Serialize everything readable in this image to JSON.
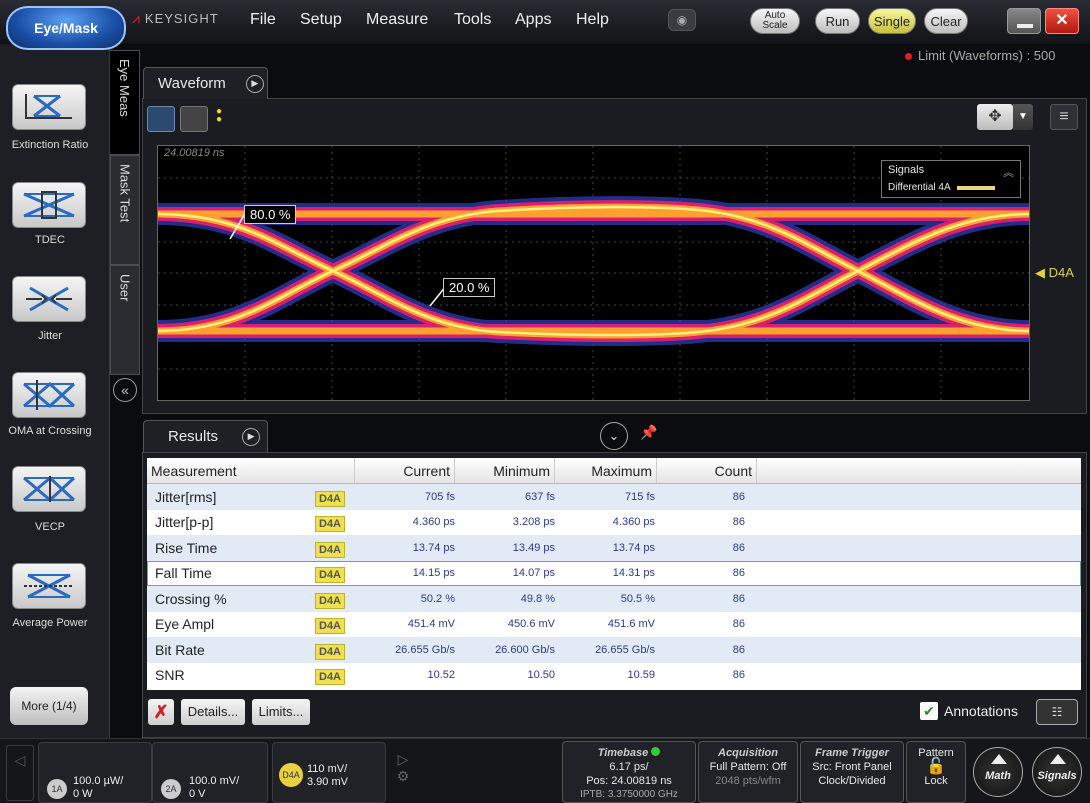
{
  "app": {
    "mode_button": "Eye/Mask",
    "brand": "KEYSIGHT"
  },
  "menu": [
    "File",
    "Setup",
    "Measure",
    "Tools",
    "Apps",
    "Help"
  ],
  "toolbar": {
    "autoscale_line1": "Auto",
    "autoscale_line2": "Scale",
    "run": "Run",
    "single": "Single",
    "clear": "Clear",
    "close": "✕"
  },
  "limit_text": "Limit (Waveforms) : 500",
  "left_panel": {
    "items": [
      {
        "label": "Extinction Ratio",
        "icon": "extinction-ratio-icon"
      },
      {
        "label": "TDEC",
        "icon": "tdec-icon"
      },
      {
        "label": "Jitter",
        "icon": "jitter-icon"
      },
      {
        "label": "OMA at Crossing",
        "icon": "oma-crossing-icon"
      },
      {
        "label": "VECP",
        "icon": "vecp-icon"
      },
      {
        "label": "Average Power",
        "icon": "average-power-icon"
      }
    ],
    "more": "More (1/4)"
  },
  "vertical_tabs": [
    "Eye Meas",
    "Mask Test",
    "User"
  ],
  "waveform": {
    "tab": "Waveform",
    "time_label": "24.00819 ns",
    "signals_title": "Signals",
    "signal_name": "Differential 4A",
    "signal_color": "#e8d878",
    "marker": "◀ D4A",
    "annotation_high": "80.0 %",
    "annotation_low": "20.0 %"
  },
  "results": {
    "tab": "Results",
    "headers": [
      "Measurement",
      "Current",
      "Minimum",
      "Maximum",
      "Count"
    ],
    "rows": [
      {
        "name": "Jitter[rms]",
        "src": "D4A",
        "current": "705 fs",
        "minimum": "637 fs",
        "maximum": "715 fs",
        "count": "86"
      },
      {
        "name": "Jitter[p-p]",
        "src": "D4A",
        "current": "4.360 ps",
        "minimum": "3.208 ps",
        "maximum": "4.360 ps",
        "count": "86"
      },
      {
        "name": "Rise Time",
        "src": "D4A",
        "current": "13.74 ps",
        "minimum": "13.49 ps",
        "maximum": "13.74 ps",
        "count": "86"
      },
      {
        "name": "Fall Time",
        "src": "D4A",
        "current": "14.15 ps",
        "minimum": "14.07 ps",
        "maximum": "14.31 ps",
        "count": "86"
      },
      {
        "name": "Crossing %",
        "src": "D4A",
        "current": "50.2 %",
        "minimum": "49.8 %",
        "maximum": "50.5 %",
        "count": "86"
      },
      {
        "name": "Eye Ampl",
        "src": "D4A",
        "current": "451.4 mV",
        "minimum": "450.6 mV",
        "maximum": "451.6 mV",
        "count": "86"
      },
      {
        "name": "Bit Rate",
        "src": "D4A",
        "current": "26.655 Gb/s",
        "minimum": "26.600 Gb/s",
        "maximum": "26.655 Gb/s",
        "count": "86"
      },
      {
        "name": "SNR",
        "src": "D4A",
        "current": "10.52",
        "minimum": "10.50",
        "maximum": "10.59",
        "count": "86"
      }
    ],
    "details": "Details...",
    "limits": "Limits...",
    "annotations": "Annotations"
  },
  "bottom": {
    "ch1": {
      "id": "1A",
      "line1": "100.0 µW/",
      "line2": "0 W"
    },
    "ch2": {
      "id": "2A",
      "line1": "100.0 mV/",
      "line2": "0 V"
    },
    "ch4": {
      "id": "D4A",
      "line1": "110 mV/",
      "line2": "3.90 mV"
    },
    "timebase": {
      "title": "Timebase",
      "l1": "6.17 ps/",
      "l2": "Pos: 24.00819 ns",
      "l3": "IPTB: 3.3750000 GHz"
    },
    "acquisition": {
      "title": "Acquisition",
      "l1": "Full Pattern: Off",
      "l2": "2048 pts/wfm"
    },
    "trigger": {
      "title": "Frame Trigger",
      "l1": "Src: Front Panel",
      "l2": "Clock/Divided"
    },
    "pattern": {
      "title": "Pattern",
      "lock": "Lock"
    },
    "math": "Math",
    "signals": "Signals"
  }
}
